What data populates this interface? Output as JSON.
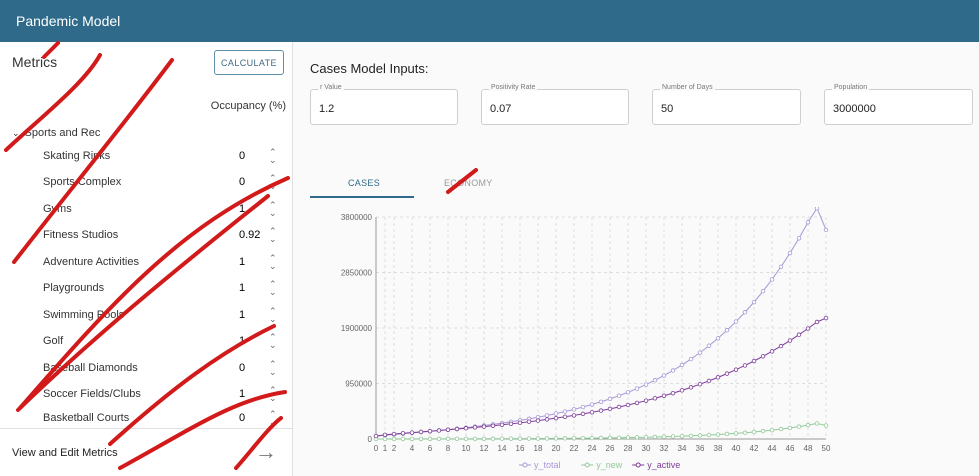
{
  "app": {
    "title": "Pandemic Model"
  },
  "sidebar": {
    "title": "Metrics",
    "calculate_label": "CALCULATE",
    "occupancy_header": "Occupancy (%)",
    "group_label": "Sports and Rec",
    "items": [
      {
        "label": "Skating Rinks",
        "value": "0"
      },
      {
        "label": "Sports Complex",
        "value": "0"
      },
      {
        "label": "Gyms",
        "value": "1"
      },
      {
        "label": "Fitness Studios",
        "value": "0.92"
      },
      {
        "label": "Adventure Activities",
        "value": "1"
      },
      {
        "label": "Playgrounds",
        "value": "1"
      },
      {
        "label": "Swimming Pools",
        "value": "1"
      },
      {
        "label": "Golf",
        "value": "1"
      },
      {
        "label": "Baseball Diamonds",
        "value": "0"
      },
      {
        "label": "Soccer Fields/Clubs",
        "value": "1"
      },
      {
        "label": "Basketball Courts",
        "value": "0"
      }
    ],
    "footer_label": "View and Edit Metrics"
  },
  "main": {
    "inputs_title": "Cases Model Inputs:",
    "fields": [
      {
        "label": "r Value",
        "value": "1.2"
      },
      {
        "label": "Positivity Rate",
        "value": "0.07"
      },
      {
        "label": "Number of Days",
        "value": "50"
      },
      {
        "label": "Population",
        "value": "3000000"
      }
    ],
    "tabs": [
      {
        "label": "CASES"
      },
      {
        "label": "ECONOMY"
      }
    ]
  },
  "colors": {
    "appbar": "#2f6a8a",
    "y_total": "#a897d6",
    "y_new": "#92c99a",
    "y_active": "#7d3c98",
    "annotation_marks": "#d21a1a"
  },
  "chart_data": {
    "type": "line",
    "x": [
      0,
      1,
      2,
      3,
      4,
      5,
      6,
      7,
      8,
      9,
      10,
      11,
      12,
      13,
      14,
      15,
      16,
      17,
      18,
      19,
      20,
      21,
      22,
      23,
      24,
      25,
      26,
      27,
      28,
      29,
      30,
      31,
      32,
      33,
      34,
      35,
      36,
      37,
      38,
      39,
      40,
      41,
      42,
      43,
      44,
      45,
      46,
      47,
      48,
      49,
      50
    ],
    "xticks": [
      0,
      1,
      2,
      4,
      6,
      8,
      10,
      12,
      14,
      16,
      18,
      20,
      22,
      24,
      26,
      28,
      30,
      32,
      34,
      36,
      38,
      40,
      42,
      44,
      46,
      48,
      50
    ],
    "yticks": [
      0,
      950000,
      1900000,
      2850000,
      3800000
    ],
    "ylim": [
      0,
      3800000
    ],
    "xlim": [
      0,
      50
    ],
    "grid": true,
    "legend": "bottom",
    "series": [
      {
        "name": "y_total",
        "values": [
          50000,
          65000,
          78000,
          91000,
          104000,
          117000,
          131000,
          146000,
          161000,
          177000,
          194000,
          212000,
          231000,
          251000,
          272000,
          295000,
          319000,
          345000,
          373000,
          403000,
          435000,
          470000,
          507000,
          547000,
          590000,
          637000,
          687000,
          741000,
          800000,
          863000,
          932000,
          1006000,
          1086000,
          1173000,
          1267000,
          1368000,
          1478000,
          1596000,
          1724000,
          1862000,
          2010000,
          2170000,
          2343000,
          2530000,
          2731000,
          2948000,
          3183000,
          3436000,
          3710000,
          3950000,
          3580000
        ]
      },
      {
        "name": "y_new",
        "values": [
          0,
          1000,
          1100,
          1300,
          1500,
          1700,
          1900,
          2200,
          2500,
          2800,
          3100,
          3500,
          4000,
          4500,
          5000,
          5600,
          6300,
          7100,
          7900,
          8900,
          10000,
          11200,
          12500,
          14000,
          15700,
          17600,
          19700,
          22100,
          24700,
          27700,
          31000,
          34700,
          38900,
          43500,
          48700,
          54600,
          61100,
          68400,
          76600,
          85800,
          96100,
          107600,
          120500,
          135000,
          151200,
          169300,
          189600,
          212400,
          237900,
          266400,
          230000
        ]
      },
      {
        "name": "y_active",
        "values": [
          50000,
          72000,
          85000,
          98000,
          110000,
          122000,
          134000,
          146000,
          158000,
          171000,
          184000,
          198000,
          212000,
          227000,
          243000,
          260000,
          277000,
          296000,
          315000,
          336000,
          357000,
          380000,
          404000,
          430000,
          457000,
          486000,
          516000,
          548000,
          582000,
          618000,
          656000,
          697000,
          740000,
          785000,
          833000,
          884000,
          938000,
          995000,
          1055000,
          1119000,
          1187000,
          1259000,
          1335000,
          1415000,
          1500000,
          1590000,
          1685000,
          1785000,
          1891000,
          2003000,
          2070000
        ]
      }
    ]
  }
}
